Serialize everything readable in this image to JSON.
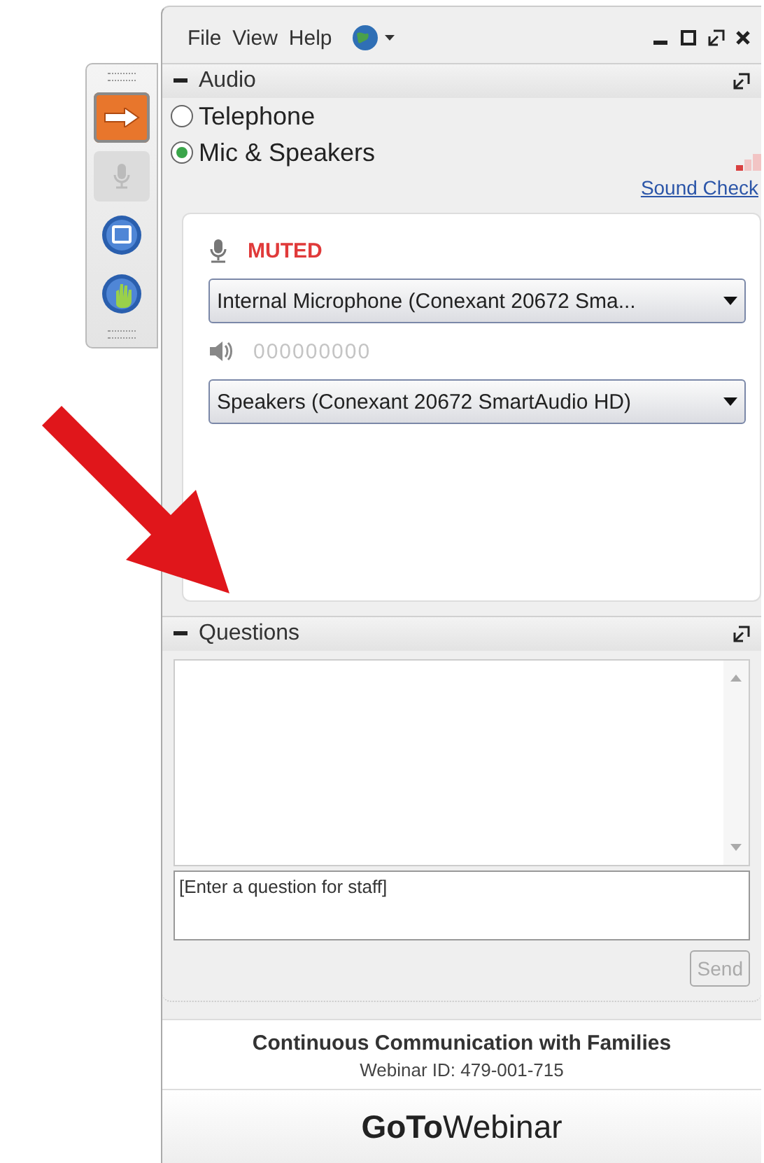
{
  "toolbar": {
    "buttons": [
      {
        "kind": "arrow",
        "selected": true,
        "disabled": false
      },
      {
        "kind": "mic",
        "selected": false,
        "disabled": true
      },
      {
        "kind": "screen",
        "selected": false,
        "disabled": false
      },
      {
        "kind": "hand",
        "selected": false,
        "disabled": false
      }
    ]
  },
  "menu": [
    "File",
    "View",
    "Help"
  ],
  "audio": {
    "title": "Audio",
    "options": [
      {
        "label": "Telephone",
        "selected": false
      },
      {
        "label": "Mic & Speakers",
        "selected": true
      }
    ],
    "sound_check": "Sound Check",
    "mic": {
      "status": "MUTED",
      "device": "Internal Microphone (Conexant 20672 Sma..."
    },
    "speaker": {
      "meter": "000000000",
      "device": "Speakers (Conexant 20672 SmartAudio HD)"
    }
  },
  "questions": {
    "title": "Questions",
    "placeholder": "[Enter a question for staff]",
    "send": {
      "label": "Send",
      "disabled": true
    }
  },
  "footer": {
    "title": "Continuous Communication with Families",
    "webinar_id": "Webinar ID: 479-001-715",
    "logo": "**GoTo**Webinar"
  }
}
